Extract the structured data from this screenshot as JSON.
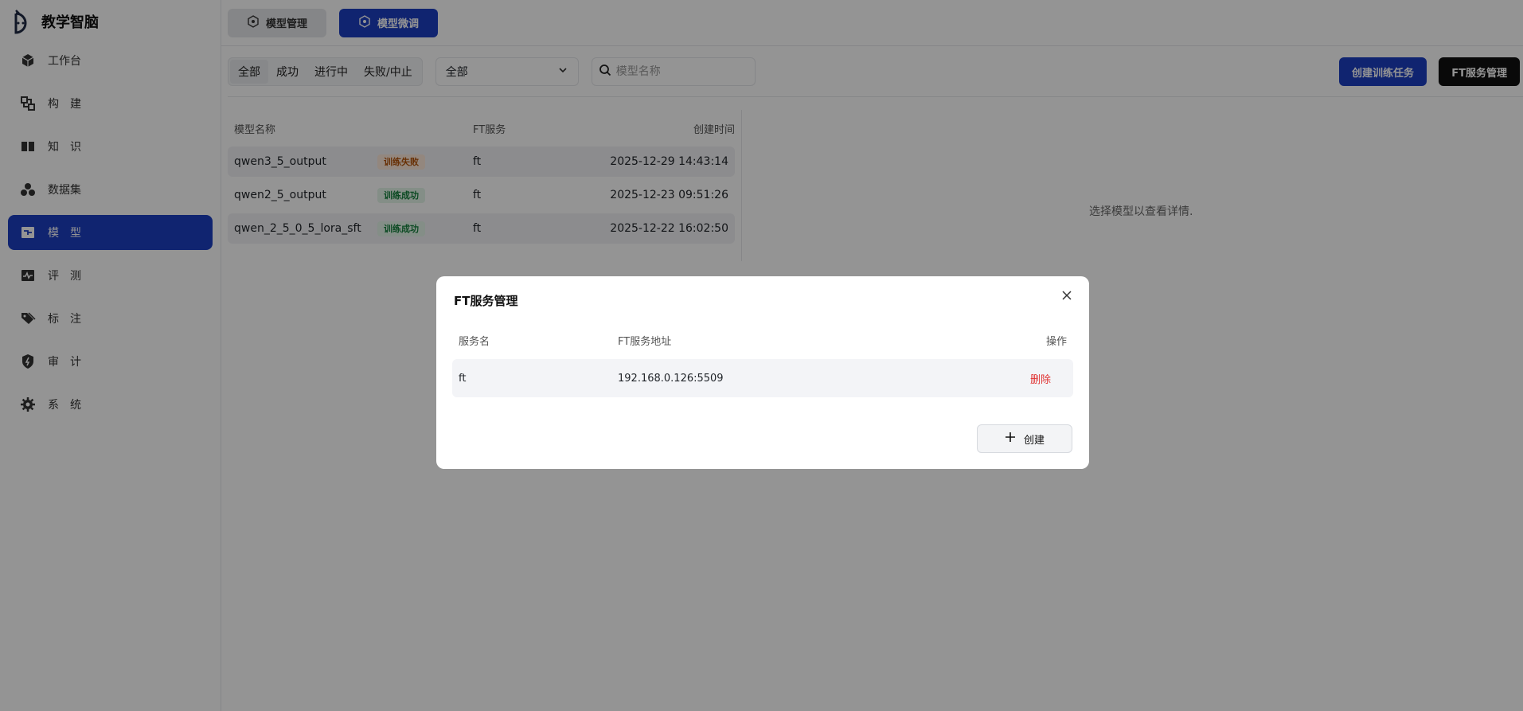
{
  "brand": {
    "title": "教学智脑"
  },
  "sidebar": {
    "items": [
      {
        "label": "工作台",
        "icon": "cube-icon"
      },
      {
        "label": "构建",
        "icon": "build-icon"
      },
      {
        "label": "知识",
        "icon": "book-icon"
      },
      {
        "label": "数据集",
        "icon": "dataset-icon"
      },
      {
        "label": "模型",
        "icon": "model-icon",
        "active": true
      },
      {
        "label": "评测",
        "icon": "pulse-icon"
      },
      {
        "label": "标注",
        "icon": "tag-icon"
      },
      {
        "label": "审计",
        "icon": "shield-icon"
      },
      {
        "label": "系统",
        "icon": "gear-icon"
      }
    ]
  },
  "topbar": {
    "tab_model_manage": "模型管理",
    "tab_model_finetune": "模型微调"
  },
  "toolbar": {
    "filters": [
      "全部",
      "成功",
      "进行中",
      "失败/中止"
    ],
    "select_value": "全部",
    "search_placeholder": "模型名称",
    "create_task": "创建训练任务",
    "ft_service_manage": "FT服务管理"
  },
  "list": {
    "headers": {
      "name": "模型名称",
      "ft": "FT服务",
      "time": "创建时间"
    },
    "rows": [
      {
        "name": "qwen3_5_output",
        "status": "训练失败",
        "ft": "ft",
        "time": "2025-12-29 14:43:14"
      },
      {
        "name": "qwen2_5_output",
        "status": "训练成功",
        "ft": "ft",
        "time": "2025-12-23 09:51:26"
      },
      {
        "name": "qwen_2_5_0_5_lora_sft",
        "status": "训练成功",
        "ft": "ft",
        "time": "2025-12-22 16:02:50"
      }
    ]
  },
  "detail": {
    "empty": "选择模型以查看详情."
  },
  "modal": {
    "title": "FT服务管理",
    "headers": {
      "name": "服务名",
      "address": "FT服务地址",
      "action": "操作"
    },
    "rows": [
      {
        "name": "ft",
        "address": "192.168.0.126:5509",
        "action": "删除"
      }
    ],
    "create_label": "创建"
  },
  "colors": {
    "primary": "#1d3fc1",
    "dark": "#111111",
    "danger": "#e03131"
  }
}
